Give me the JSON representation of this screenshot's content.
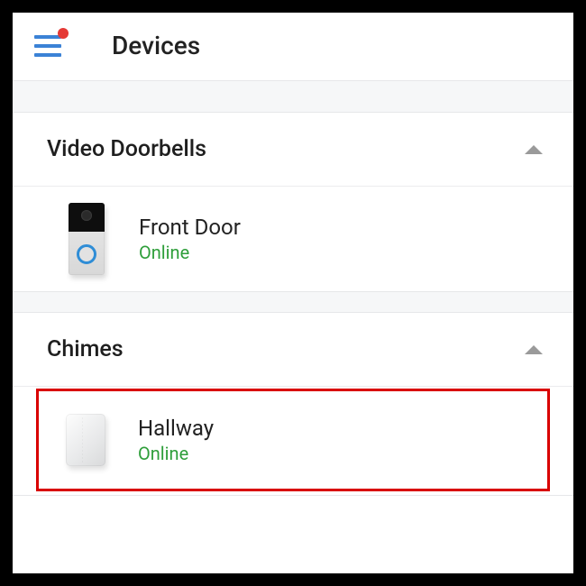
{
  "header": {
    "title": "Devices"
  },
  "sections": [
    {
      "title": "Video Doorbells",
      "devices": [
        {
          "name": "Front Door",
          "status": "Online",
          "status_class": "online",
          "highlighted": false,
          "icon": "doorbell"
        }
      ]
    },
    {
      "title": "Chimes",
      "devices": [
        {
          "name": "Hallway",
          "status": "Online",
          "status_class": "online",
          "highlighted": true,
          "icon": "chime"
        }
      ]
    }
  ],
  "colors": {
    "accent": "#3b82d6",
    "notification": "#e53935",
    "online": "#2e9e3a",
    "highlight_border": "#d90000"
  }
}
